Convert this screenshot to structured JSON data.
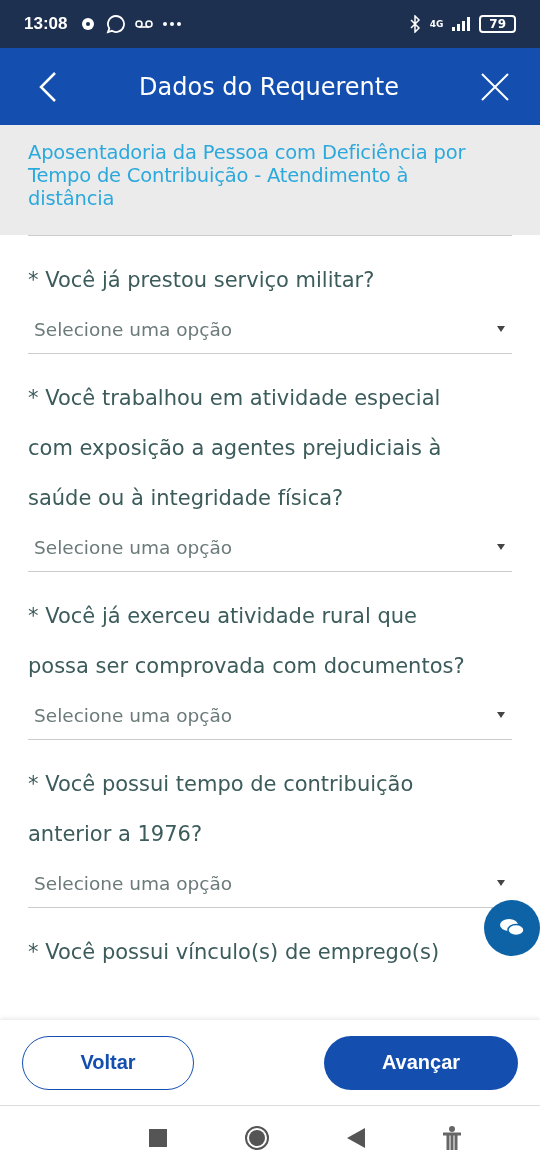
{
  "status_bar": {
    "time": "13:08",
    "network": "4G",
    "battery": "79"
  },
  "header": {
    "title": "Dados do Requerente"
  },
  "service_title": "Aposentadoria da Pessoa com Deficiência por Tempo de Contribuição - Atendimento à distância",
  "questions": [
    {
      "label": "* Você já prestou serviço militar?",
      "select": {
        "placeholder": "Selecione uma opção"
      }
    },
    {
      "label": "* Você trabalhou em atividade especial com exposição a agentes prejudiciais à saúde ou à integridade física?",
      "select": {
        "placeholder": "Selecione uma opção"
      }
    },
    {
      "label": "* Você já exerceu atividade rural que possa ser comprovada com documentos?",
      "select": {
        "placeholder": "Selecione uma opção"
      }
    },
    {
      "label": "* Você possui tempo de contribuição anterior a 1976?",
      "select": {
        "placeholder": "Selecione uma opção"
      }
    },
    {
      "label": "* Você possui vínculo(s) de emprego(s)"
    }
  ],
  "buttons": [
    {
      "label": "Voltar",
      "kind": "secondary"
    },
    {
      "label": "Avançar",
      "kind": "primary"
    }
  ]
}
